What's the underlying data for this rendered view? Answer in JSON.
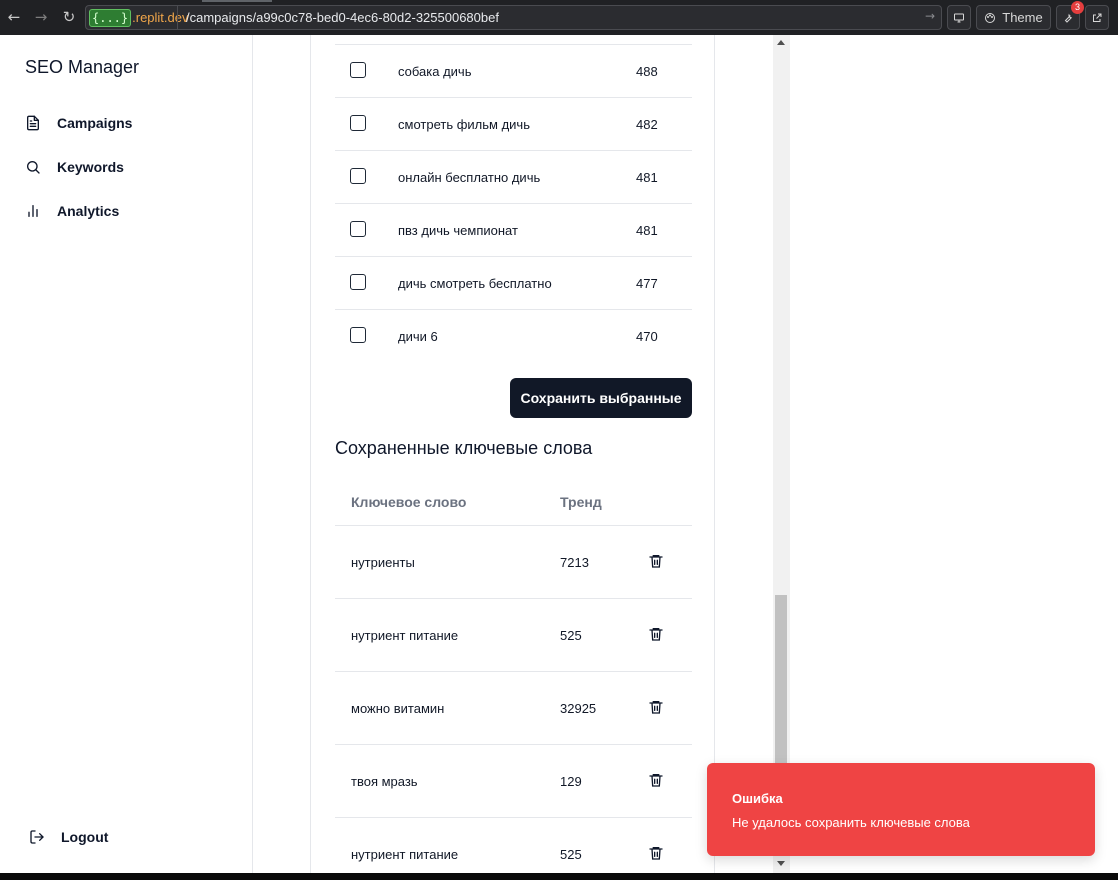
{
  "browser": {
    "url_badge": "{...}",
    "url_domain": ".replit.dev",
    "url_path": "/campaigns/a99c0c78-bed0-4ec6-80d2-325500680bef",
    "theme_label": "Theme",
    "extension_count": "3"
  },
  "sidebar": {
    "brand": "SEO Manager",
    "items": [
      {
        "label": "Campaigns",
        "icon": "file-text-icon"
      },
      {
        "label": "Keywords",
        "icon": "search-icon"
      },
      {
        "label": "Analytics",
        "icon": "bar-chart-icon"
      }
    ],
    "logout_label": "Logout"
  },
  "suggestions": [
    {
      "keyword": "собака дичь",
      "volume": "488"
    },
    {
      "keyword": "смотреть фильм дичь",
      "volume": "482"
    },
    {
      "keyword": "онлайн бесплатно дичь",
      "volume": "481"
    },
    {
      "keyword": "пвз дичь чемпионат",
      "volume": "481"
    },
    {
      "keyword": "дичь смотреть бесплатно",
      "volume": "477"
    },
    {
      "keyword": "дичи 6",
      "volume": "470"
    }
  ],
  "save_button_label": "Сохранить выбранные",
  "saved": {
    "title": "Сохраненные ключевые слова",
    "col_keyword": "Ключевое слово",
    "col_trend": "Тренд",
    "rows": [
      {
        "keyword": "нутриенты",
        "trend": "7213"
      },
      {
        "keyword": "нутриент питание",
        "trend": "525"
      },
      {
        "keyword": "можно витамин",
        "trend": "32925"
      },
      {
        "keyword": "твоя мразь",
        "trend": "129"
      },
      {
        "keyword": "нутриент питание",
        "trend": "525"
      }
    ]
  },
  "toast": {
    "title": "Ошибка",
    "message": "Не удалось сохранить ключевые слова",
    "color": "#ef4444"
  },
  "colors": {
    "primary_button": "#111827",
    "toast_error": "#ef4444",
    "border": "#e5e7eb"
  }
}
